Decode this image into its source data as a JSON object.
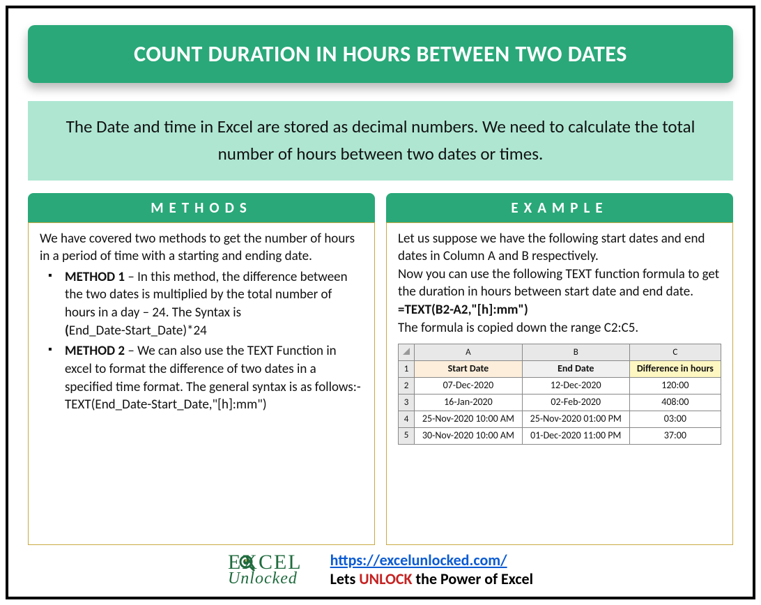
{
  "title": "COUNT DURATION IN HOURS BETWEEN TWO DATES",
  "intro": "The Date and time in Excel are stored as decimal numbers. We need to calculate the total number of hours between two dates or times.",
  "methods": {
    "heading": "METHODS",
    "lead": "We have covered two methods to get the number of hours in a period of time with a starting and ending date.",
    "m1_label": "METHOD 1",
    "m1_text": " – In this method, the difference between the two dates is multiplied by the total number of hours in a day – 24. The Syntax is",
    "m1_syntax": "(End_Date-Start_Date)*24",
    "m2_label": "METHOD 2",
    "m2_text": " – We can also use the TEXT Function in excel to format the difference of two dates in a specified time format. The general syntax is as follows:-",
    "m2_syntax": "TEXT(End_Date-Start_Date,\"[h]:mm\")"
  },
  "example": {
    "heading": "EXAMPLE",
    "p1": "Let us suppose we have the following start dates and end dates in Column A and B respectively.",
    "p2": "Now you can use the following TEXT function formula to get the duration in hours between start date and end date.",
    "formula": "=TEXT(B2-A2,\"[h]:mm\")",
    "p3": "The formula is copied down the range C2:C5."
  },
  "grid": {
    "colA": "A",
    "colB": "B",
    "colC": "C",
    "hA": "Start Date",
    "hB": "End Date",
    "hC": "Difference in hours",
    "rows": [
      {
        "n": "2",
        "a": "07-Dec-2020",
        "b": "12-Dec-2020",
        "c": "120:00"
      },
      {
        "n": "3",
        "a": "16-Jan-2020",
        "b": "02-Feb-2020",
        "c": "408:00"
      },
      {
        "n": "4",
        "a": "25-Nov-2020 10:00 AM",
        "b": "25-Nov-2020 01:00 PM",
        "c": "03:00"
      },
      {
        "n": "5",
        "a": "30-Nov-2020 10:00 AM",
        "b": "01-Dec-2020 11:00 PM",
        "c": "37:00"
      }
    ]
  },
  "footer": {
    "brand_top": "EXCEL",
    "brand_bottom": "Unlocked",
    "url": "https://excelunlocked.com/",
    "tag_pre": "Lets ",
    "tag_unlock": "UNLOCK",
    "tag_post": " the Power of Excel"
  }
}
